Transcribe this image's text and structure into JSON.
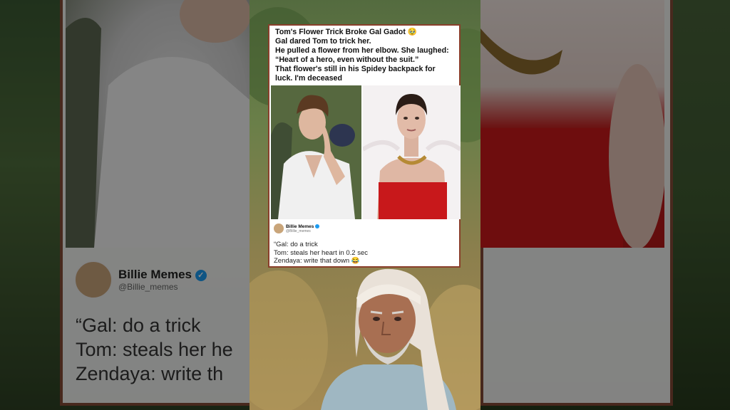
{
  "post": {
    "caption_lines": [
      "Tom's Flower Trick Broke Gal Gadot 🥹",
      "Gal dared Tom to trick her.",
      "He pulled a flower from her elbow. She laughed:",
      "“Heart of a hero, even without the suit.”",
      "That flower's still in his Spidey backpack for",
      "luck. I'm deceased"
    ]
  },
  "tweet": {
    "author": "Billie Memes",
    "handle": "@Billie_memes",
    "lines": [
      "“Gal: do a trick",
      "Tom: steals her heart in 0.2 sec",
      "Zendaya: write that down 😂"
    ]
  },
  "background_tweet": {
    "author": "Billie Memes",
    "handle": "@Billie_memes",
    "lines": [
      "“Gal: do a trick",
      "Tom: steals her he",
      "Zendaya: write th"
    ]
  },
  "colors": {
    "card_border": "#8a3f2b",
    "verified_blue": "#1d9bf0",
    "dress_red": "#c8181b"
  }
}
